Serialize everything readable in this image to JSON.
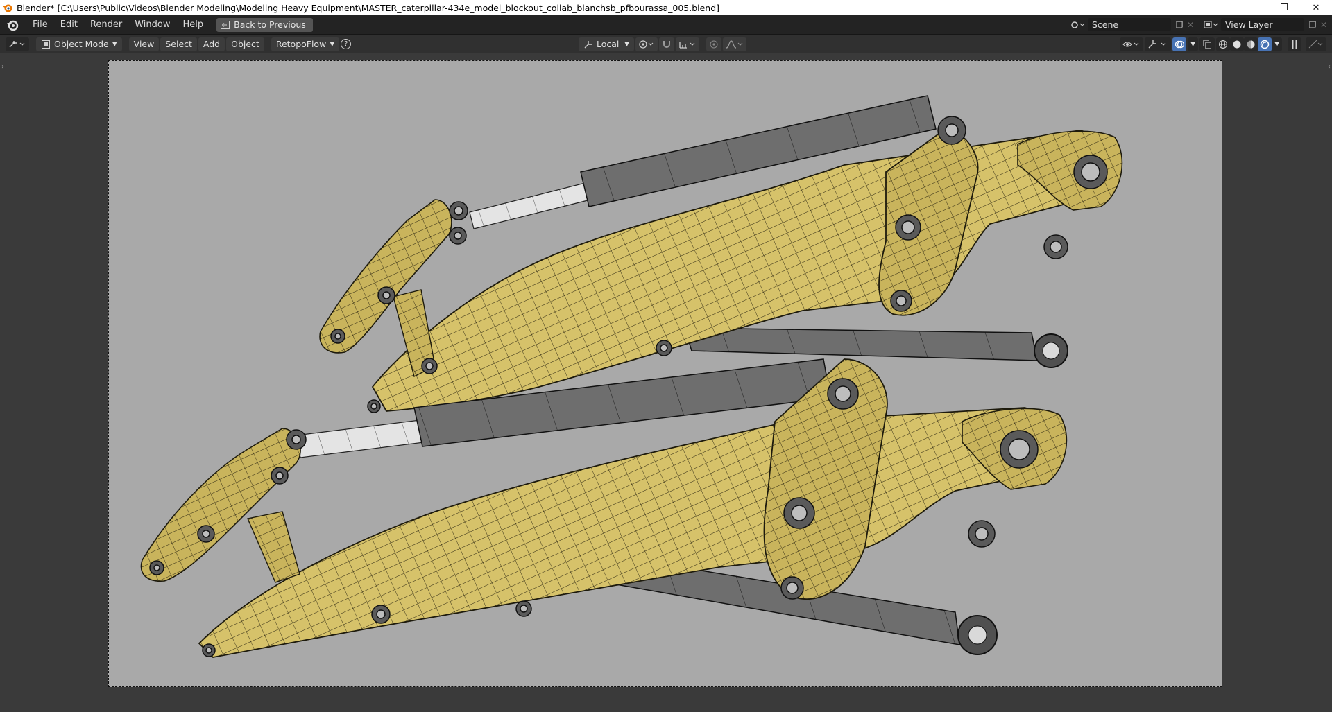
{
  "window": {
    "title": "Blender* [C:\\Users\\Public\\Videos\\Blender Modeling\\Modeling Heavy Equipment\\MASTER_caterpillar-434e_model_blockout_collab_blanchsb_pfbourassa_005.blend]",
    "controls": {
      "minimize": "—",
      "restore": "❐",
      "close": "✕"
    }
  },
  "topbar": {
    "menus": [
      "File",
      "Edit",
      "Render",
      "Window",
      "Help"
    ],
    "back_button": "Back to Previous",
    "scene": "Scene",
    "view_layer": "View Layer"
  },
  "viewport_header": {
    "mode": "Object Mode",
    "menus": [
      "View",
      "Select",
      "Add",
      "Object"
    ],
    "addon": "RetopoFlow",
    "help": "?",
    "transform_orientation": "Local"
  },
  "colors": {
    "accent": "#4772b3",
    "background": "#a9a9a9",
    "model_yellow": "#d8c46a",
    "model_gray": "#6b6b6b",
    "wire": "#1a1a1a"
  }
}
